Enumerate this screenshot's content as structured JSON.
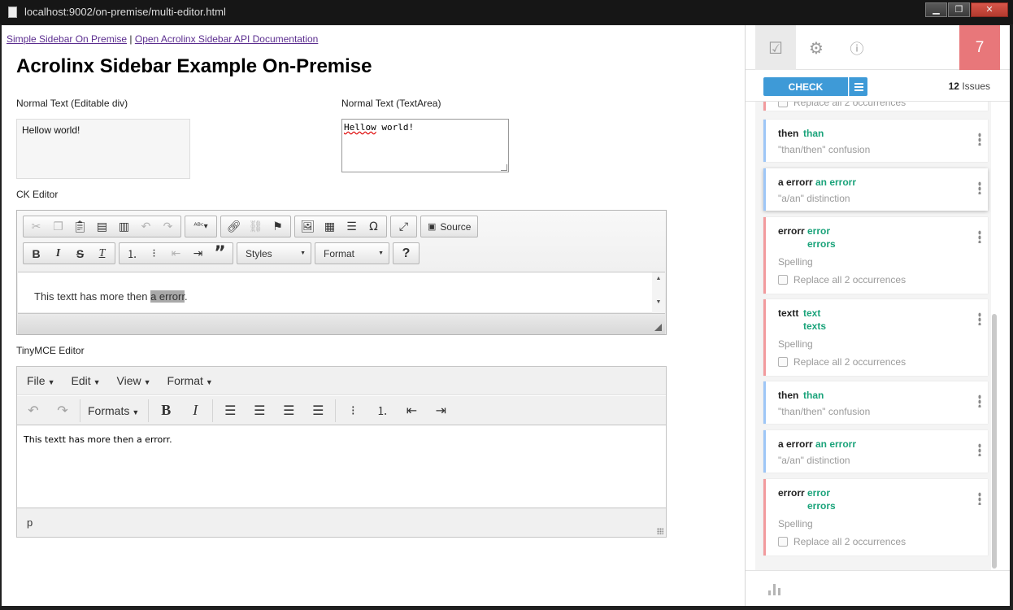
{
  "window": {
    "title": "localhost:9002/on-premise/multi-editor.html",
    "btn_min": "▁",
    "btn_max": "❐",
    "btn_close": "✕"
  },
  "page": {
    "link1": "Simple Sidebar On Premise",
    "separator": " | ",
    "link2": "Open Acrolinx Sidebar API Documentation",
    "heading": "Acrolinx Sidebar Example On-Premise",
    "label_div": "Normal Text (Editable div)",
    "div_text": "Hellow world!",
    "label_textarea": "Normal Text (TextArea)",
    "textarea_word1": "Hellow",
    "textarea_rest": " world!",
    "label_ck": "CK Editor",
    "label_tiny": "TinyMCE Editor"
  },
  "ck": {
    "source_label": "Source",
    "styles_label": "Styles",
    "format_label": "Format",
    "help_label": "?",
    "text_before": "This textt has more then ",
    "text_highlight": "a errorr",
    "text_after": "."
  },
  "tiny": {
    "menu": [
      "File",
      "Edit",
      "View",
      "Format"
    ],
    "formats_label": "Formats",
    "body_text": "This textt has more then a errorr.",
    "status_path": "p"
  },
  "sidebar": {
    "issue_badge": "7",
    "check_label": "CHECK",
    "issues_number": "12",
    "issues_word": " Issues",
    "cards": [
      {
        "word": "then",
        "suggestions": [
          "than"
        ],
        "desc": "\"than/then\" confusion",
        "replace": "",
        "color": "blue"
      },
      {
        "word": "a errorr",
        "suggestions": [
          "an errorr"
        ],
        "desc": "\"a/an\" distinction",
        "replace": "",
        "color": "blue"
      },
      {
        "word": "errorr",
        "suggestions": [
          "error",
          "errors"
        ],
        "desc": "Spelling",
        "replace": "Replace all 2 occurrences",
        "color": "red"
      },
      {
        "word": "textt",
        "suggestions": [
          "text",
          "texts"
        ],
        "desc": "Spelling",
        "replace": "Replace all 2 occurrences",
        "color": "red"
      },
      {
        "word": "then",
        "suggestions": [
          "than"
        ],
        "desc": "\"than/then\" confusion",
        "replace": "",
        "color": "blue"
      },
      {
        "word": "a errorr",
        "suggestions": [
          "an errorr"
        ],
        "desc": "\"a/an\" distinction",
        "replace": "",
        "color": "blue"
      },
      {
        "word": "errorr",
        "suggestions": [
          "error",
          "errors"
        ],
        "desc": "Spelling",
        "replace": "Replace all 2 occurrences",
        "color": "red"
      }
    ],
    "partial_replace": "Replace all 2 occurrences",
    "accent_color": "#3e9ad7",
    "badge_color": "#e8777a",
    "suggestion_color": "#1aa37a"
  }
}
